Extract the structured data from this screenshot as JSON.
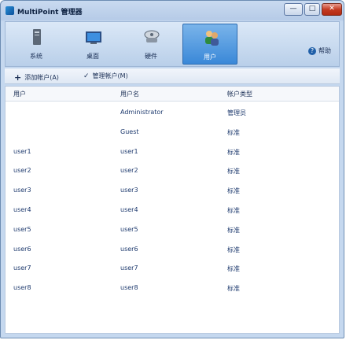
{
  "window": {
    "title": "MultiPoint 管理器",
    "minimize": "—",
    "maximize": "□",
    "close": "✕"
  },
  "tabs": [
    {
      "label": "系统",
      "icon": "tower-icon"
    },
    {
      "label": "桌面",
      "icon": "monitor-icon"
    },
    {
      "label": "硬件",
      "icon": "hardware-icon"
    },
    {
      "label": "用户",
      "icon": "users-icon",
      "active": true
    }
  ],
  "help_label": "帮助",
  "toolbar": {
    "add_label": "添加帐户(A)",
    "manage_label": "管理帐户(M)"
  },
  "table": {
    "headers": [
      "用户",
      "用户名",
      "帐户类型"
    ],
    "rows": [
      [
        "",
        "Administrator",
        "管理员"
      ],
      [
        "",
        "Guest",
        "标准"
      ],
      [
        "user1",
        "user1",
        "标准"
      ],
      [
        "user2",
        "user2",
        "标准"
      ],
      [
        "user3",
        "user3",
        "标准"
      ],
      [
        "user4",
        "user4",
        "标准"
      ],
      [
        "user5",
        "user5",
        "标准"
      ],
      [
        "user6",
        "user6",
        "标准"
      ],
      [
        "user7",
        "user7",
        "标准"
      ],
      [
        "user8",
        "user8",
        "标准"
      ]
    ]
  },
  "colors": {
    "accent": "#3a88d8",
    "title_bg": "#b6cbe7"
  }
}
